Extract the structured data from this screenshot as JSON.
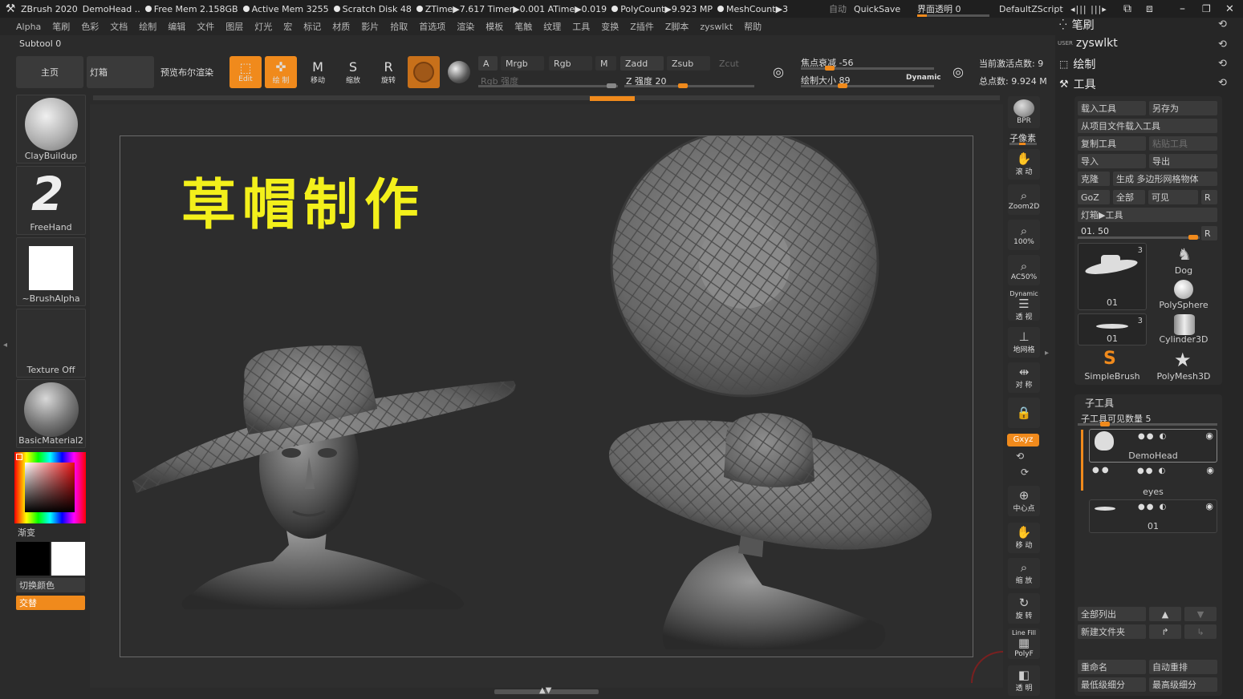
{
  "titlebar": {
    "app": "ZBrush 2020",
    "doc": "DemoHead ..",
    "free_mem": "Free Mem 2.158GB",
    "active_mem": "Active Mem 3255",
    "scratch": "Scratch Disk 48",
    "ztime": "ZTime▶7.617 Timer▶0.001 ATime▶0.019",
    "polycount": "PolyCount▶9.923 MP",
    "meshcount": "MeshCount▶3",
    "auto": "自动",
    "quicksave": "QuickSave",
    "transparency": "界面透明 0",
    "script": "DefaultZScript"
  },
  "menu": [
    "Alpha",
    "笔刷",
    "色彩",
    "文档",
    "绘制",
    "编辑",
    "文件",
    "图层",
    "灯光",
    "宏",
    "标记",
    "材质",
    "影片",
    "拾取",
    "首选项",
    "渲染",
    "模板",
    "笔触",
    "纹理",
    "工具",
    "变换",
    "Z插件",
    "Z脚本",
    "zyswlkt",
    "帮助"
  ],
  "subtool_label": "Subtool 0",
  "toolbar": {
    "home": "主页",
    "lightbox": "灯箱",
    "bpr_preview": "预览布尔渲染",
    "edit": "Edit",
    "draw": "绘 制",
    "move": "移动",
    "scale": "缩放",
    "rotate": "旋转",
    "a": "A",
    "mrgb": "Mrgb",
    "rgb": "Rgb",
    "m": "M",
    "zadd": "Zadd",
    "zsub": "Zsub",
    "zcut": "Zcut",
    "rgb_intensity": "Rgb 强度",
    "z_intensity": "Z 强度 20",
    "focal": "焦点衰减 -56",
    "draw_size": "绘制大小 89",
    "dynamic": "Dynamic",
    "active_points": "当前激活点数: 9",
    "total_points": "总点数: 9.924 M"
  },
  "shelf": {
    "brush": "ClayBuildup",
    "stroke": "FreeHand",
    "alpha": "~BrushAlpha",
    "texture": "Texture Off",
    "material": "BasicMaterial2",
    "gradient": "渐变",
    "switch_color": "切换颜色",
    "alternate": "交替"
  },
  "canvas": {
    "headline": "草帽制作"
  },
  "right_strip": {
    "bpr": "BPR",
    "subpixel": "子像素",
    "scroll": "滚 动",
    "zoom2d": "Zoom2D",
    "zoom100": "100%",
    "ac50": "AC50%",
    "persp": "透 视",
    "dynamic": "Dynamic",
    "floor": "地网格",
    "sym": "对 称",
    "xyz": "Gxyz",
    "center": "中心点",
    "move": "移 动",
    "scale": "缩 放",
    "rotate": "旋 转",
    "linefill": "Line Fill",
    "polyf": "PolyF",
    "transp": "透 明"
  },
  "right_panel": {
    "brush_title": "笔刷",
    "user": "USER",
    "user_title": "zyswlkt",
    "draw_title": "绘制",
    "tool_title": "工具",
    "load_tool": "载入工具",
    "save_as": "另存为",
    "load_from_project": "从项目文件载入工具",
    "copy_tool": "复制工具",
    "paste_tool": "粘贴工具",
    "import": "导入",
    "export": "导出",
    "clone": "克隆",
    "make_polymesh": "生成 多边形网格物体",
    "goz": "GoZ",
    "all": "全部",
    "visible": "可见",
    "r": "R",
    "lightbox_tool": "灯箱▶工具",
    "slider_label": "01. 50",
    "thumbs": [
      {
        "label": "01",
        "count": "3"
      },
      {
        "label": "Dog",
        "count": ""
      },
      {
        "label": "PolySphere",
        "count": ""
      },
      {
        "label": "01",
        "count": "3"
      },
      {
        "label": "Cylinder3D",
        "count": ""
      },
      {
        "label": "SimpleBrush",
        "count": ""
      },
      {
        "label": "PolyMesh3D",
        "count": ""
      }
    ],
    "subtool_title": "子工具",
    "visible_count": "子工具可见数量 5",
    "subtools": [
      "DemoHead",
      "eyes",
      "01"
    ],
    "list_all": "全部列出",
    "new_folder": "新建文件夹",
    "rename": "重命名",
    "auto_reorder": "自动重排",
    "lowest_sub": "最低级细分",
    "highest_sub": "最高级细分"
  },
  "colors": {
    "accent": "#f08a1c",
    "headline": "#f3f01b",
    "bg": "#2b2b2b"
  }
}
